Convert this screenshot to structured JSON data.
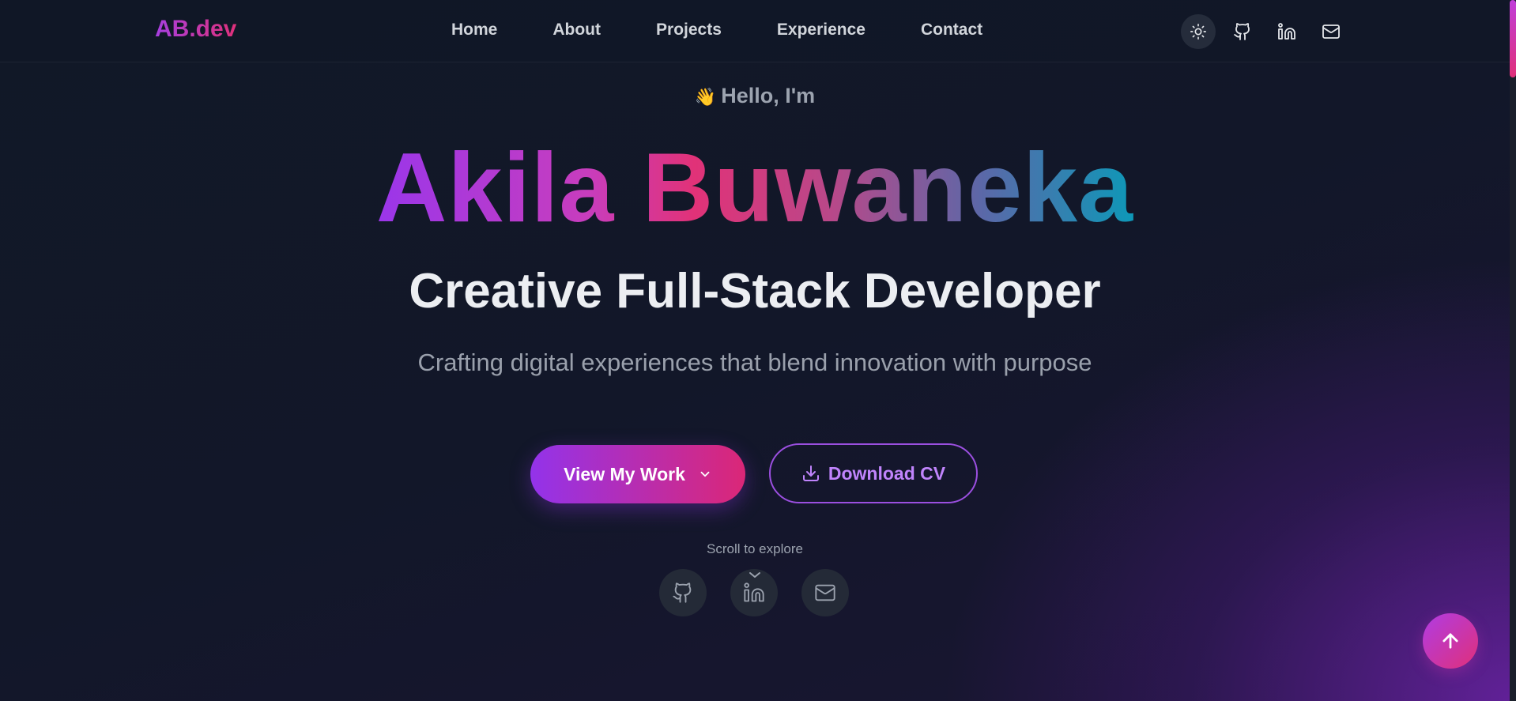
{
  "nav": {
    "logo": "AB.dev",
    "links": [
      "Home",
      "About",
      "Projects",
      "Experience",
      "Contact"
    ],
    "icons": [
      "sun-icon",
      "github-icon",
      "linkedin-icon",
      "mail-icon"
    ]
  },
  "hero": {
    "greeting_emoji": "👋",
    "greeting": "Hello, I'm",
    "name": "Akila Buwaneka",
    "role": "Creative Full-Stack Developer",
    "tagline": "Crafting digital experiences that blend innovation with purpose",
    "primary_button": "View My Work",
    "secondary_button": "Download CV",
    "scroll_hint": "Scroll to explore"
  },
  "social_icons": [
    "github-icon",
    "linkedin-icon",
    "mail-icon"
  ],
  "colors": {
    "accent_purple": "#9333ea",
    "accent_pink": "#db2777",
    "accent_teal": "#0e98b8",
    "background": "#111827"
  }
}
